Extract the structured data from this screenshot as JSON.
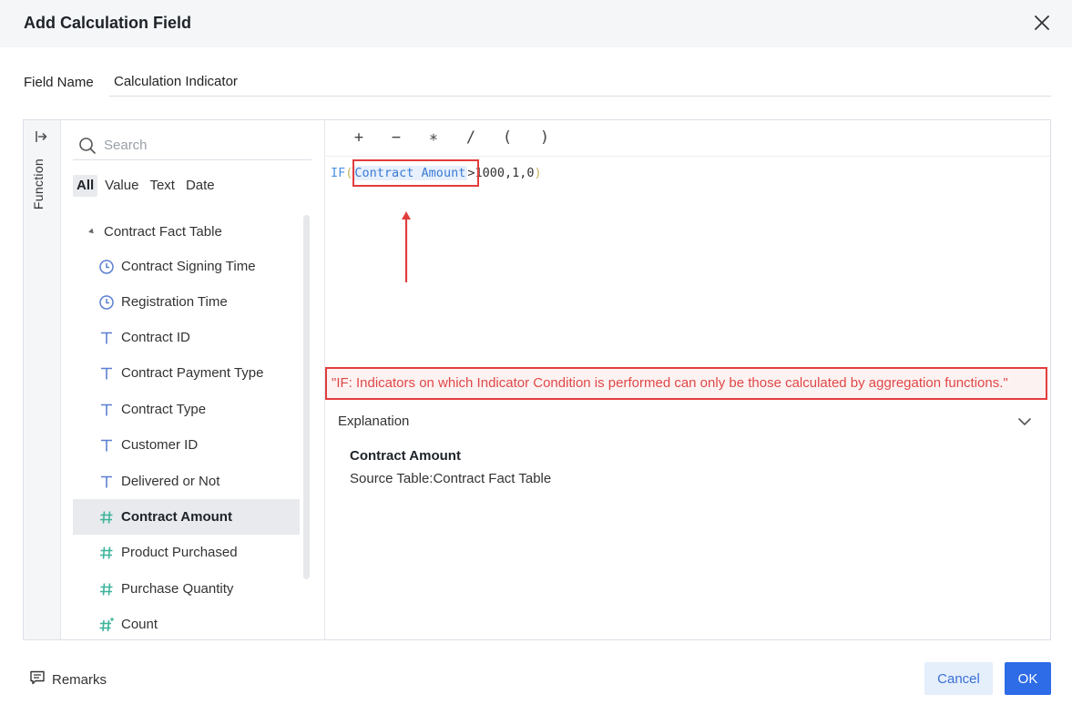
{
  "dialog": {
    "title": "Add Calculation Field"
  },
  "field_name": {
    "label": "Field Name",
    "value": "Calculation Indicator"
  },
  "sidebar": {
    "function_label": "Function"
  },
  "field_list": {
    "search_placeholder": "Search",
    "filters": [
      "All",
      "Value",
      "Text",
      "Date"
    ],
    "active_filter": "All",
    "group": "Contract Fact Table",
    "items": [
      {
        "label": "Contract Signing Time",
        "icon": "clock-icon"
      },
      {
        "label": "Registration Time",
        "icon": "clock-icon"
      },
      {
        "label": "Contract ID",
        "icon": "text-type-icon"
      },
      {
        "label": "Contract Payment Type",
        "icon": "text-type-icon"
      },
      {
        "label": "Contract Type",
        "icon": "text-type-icon"
      },
      {
        "label": "Customer ID",
        "icon": "text-type-icon"
      },
      {
        "label": "Delivered or Not",
        "icon": "text-type-icon"
      },
      {
        "label": "Contract Amount",
        "icon": "number-type-icon",
        "selected": true
      },
      {
        "label": "Product Purchased",
        "icon": "number-type-icon"
      },
      {
        "label": "Purchase Quantity",
        "icon": "number-type-icon"
      },
      {
        "label": "Count",
        "icon": "count-icon"
      }
    ]
  },
  "editor": {
    "operators": [
      "+",
      "−",
      "∗",
      "/",
      "(",
      ")"
    ],
    "formula": {
      "function": "IF",
      "open_paren": "(",
      "token": "Contract Amount",
      "rest": ">1000,1,0",
      "close_paren": ")"
    },
    "error_message": "\"IF: Indicators on which Indicator Condition is performed can only be those calculated by aggregation functions.\"",
    "explanation": {
      "header": "Explanation",
      "field_name": "Contract Amount",
      "source": "Source Table:Contract Fact Table"
    }
  },
  "footer": {
    "remarks": "Remarks",
    "cancel": "Cancel",
    "ok": "OK"
  },
  "colors": {
    "primary": "#2e6be6",
    "error": "#e23d3d",
    "number_icon": "#3cb39a",
    "time_icon": "#5b7fd0",
    "text_icon": "#5b7fd0"
  }
}
